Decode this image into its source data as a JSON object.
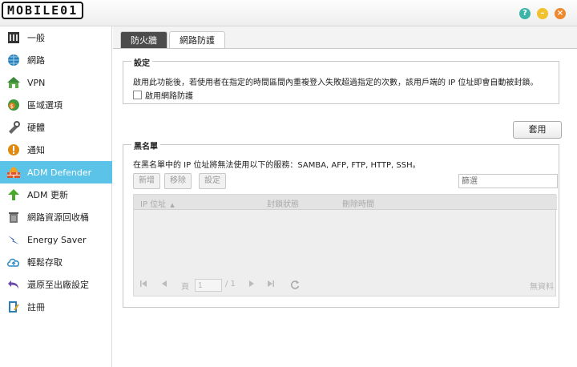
{
  "app": {
    "logo_text": "MOBILE01"
  },
  "window_controls": {
    "help_icon": "?",
    "min_icon": "–",
    "close_icon": "×"
  },
  "sidebar": {
    "items": [
      {
        "label": "一般",
        "icon": "general-icon"
      },
      {
        "label": "網路",
        "icon": "globe-icon"
      },
      {
        "label": "VPN",
        "icon": "vpn-house-icon"
      },
      {
        "label": "區域選項",
        "icon": "region-icon"
      },
      {
        "label": "硬體",
        "icon": "hardware-icon"
      },
      {
        "label": "通知",
        "icon": "notification-icon"
      },
      {
        "label": "ADM Defender",
        "icon": "firewall-icon",
        "active": true
      },
      {
        "label": "ADM 更新",
        "icon": "update-arrow-icon"
      },
      {
        "label": "網路資源回收桶",
        "icon": "recycle-bin-icon"
      },
      {
        "label": "Energy Saver",
        "icon": "energy-saver-icon"
      },
      {
        "label": "輕鬆存取",
        "icon": "cloud-access-icon"
      },
      {
        "label": "還原至出廠設定",
        "icon": "restore-icon"
      },
      {
        "label": "註冊",
        "icon": "register-icon"
      }
    ]
  },
  "main": {
    "tabs": [
      {
        "label": "防火牆"
      },
      {
        "label": "網路防護"
      }
    ],
    "settings": {
      "title": "設定",
      "description": "啟用此功能後，若使用者在指定的時間區間內重複登入失敗超過指定的次數，該用戶端的 IP 位址即會自動被封鎖。",
      "checkbox_label": "啟用網路防護"
    },
    "apply_label": "套用",
    "blacklist": {
      "title": "黑名單",
      "description": "在黑名單中的 IP 位址將無法使用以下的服務：SAMBA, AFP, FTP, HTTP, SSH。",
      "buttons": {
        "add": "新增",
        "remove": "移除",
        "settings": "設定"
      },
      "filter_placeholder": "篩選",
      "columns": [
        "IP 位址",
        "封鎖狀態",
        "刪除時間"
      ],
      "sort_indicator": "▲",
      "rows": [],
      "pager": {
        "page_label": "頁",
        "page_value": "1",
        "total": "/ 1",
        "no_data": "無資料"
      }
    }
  },
  "colors": {
    "active_sidebar": "#5bc3e8",
    "help_button": "#3cb4a8",
    "minimize_button": "#f2c12e",
    "close_button": "#ee8a2d"
  }
}
